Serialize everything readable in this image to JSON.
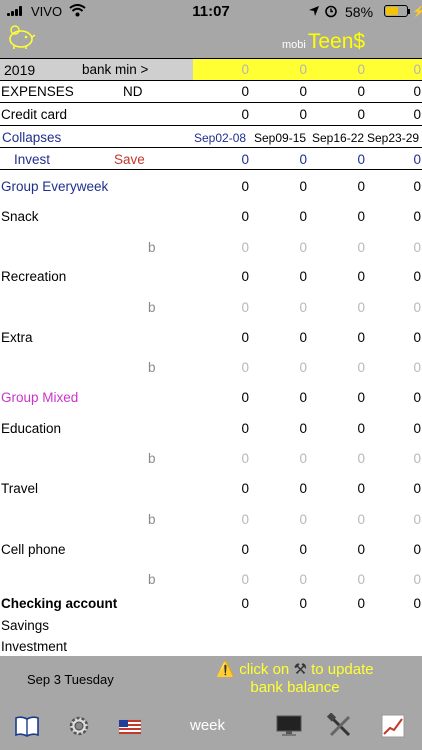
{
  "status": {
    "carrier": "VIVO",
    "time": "11:07",
    "battery": "58%",
    "battery_level": 0.58
  },
  "header": {
    "brand_small": "mobi",
    "brand_big": "Teen$"
  },
  "year_row": {
    "year": "2019",
    "label": "bank min >",
    "values": [
      "0",
      "0",
      "0",
      "0"
    ]
  },
  "expenses_row": {
    "label": "EXPENSES",
    "tag": "ND",
    "values": [
      "0",
      "0",
      "0",
      "0"
    ]
  },
  "credit_row": {
    "label": "Credit card",
    "values": [
      "0",
      "0",
      "0",
      "0"
    ]
  },
  "collapses_row": {
    "label": "Collapses",
    "weeks": [
      "Sep02-08",
      "Sep09-15",
      "Sep16-22",
      "Sep23-29"
    ]
  },
  "invest_row": {
    "invest": "Invest",
    "save": "Save",
    "values": [
      "0",
      "0",
      "0",
      "0"
    ]
  },
  "group_everyweek": {
    "label": "Group Everyweek",
    "values": [
      "0",
      "0",
      "0",
      "0"
    ]
  },
  "snack": {
    "label": "Snack",
    "values": [
      "0",
      "0",
      "0",
      "0"
    ],
    "b": "b",
    "b_values": [
      "0",
      "0",
      "0",
      "0"
    ]
  },
  "recreation": {
    "label": "Recreation",
    "values": [
      "0",
      "0",
      "0",
      "0"
    ],
    "b": "b",
    "b_values": [
      "0",
      "0",
      "0",
      "0"
    ]
  },
  "extra": {
    "label": "Extra",
    "values": [
      "0",
      "0",
      "0",
      "0"
    ],
    "b": "b",
    "b_values": [
      "0",
      "0",
      "0",
      "0"
    ]
  },
  "group_mixed": {
    "label": "Group Mixed",
    "values": [
      "0",
      "0",
      "0",
      "0"
    ]
  },
  "education": {
    "label": "Education",
    "values": [
      "0",
      "0",
      "0",
      "0"
    ],
    "b": "b",
    "b_values": [
      "0",
      "0",
      "0",
      "0"
    ]
  },
  "travel": {
    "label": "Travel",
    "values": [
      "0",
      "0",
      "0",
      "0"
    ],
    "b": "b",
    "b_values": [
      "0",
      "0",
      "0",
      "0"
    ]
  },
  "cellphone": {
    "label": "Cell phone",
    "values": [
      "0",
      "0",
      "0",
      "0"
    ],
    "b": "b",
    "b_values": [
      "0",
      "0",
      "0",
      "0"
    ]
  },
  "checking": {
    "label": "Checking account",
    "values": [
      "0",
      "0",
      "0",
      "0"
    ]
  },
  "savings": {
    "label": "Savings"
  },
  "investment": {
    "label": "Investment"
  },
  "footer": {
    "date": "Sep 3 Tuesday",
    "hint_line1": "click on",
    "hint_line1b": "to update",
    "hint_line2": "bank balance"
  },
  "tabbar": {
    "week": "week"
  },
  "icons": {
    "logo": "piggy-bank-icon",
    "book": "book-icon",
    "settings": "gear-icon",
    "flag": "us-flag-icon",
    "monitor": "monitor-icon",
    "tools": "tools-icon",
    "chart": "chart-icon",
    "warning": "warning-icon"
  },
  "colors": {
    "bar_gray": "#a7a7a7",
    "highlight_yellow": "#ffff33",
    "group_blue": "#1f2f8f",
    "group_magenta": "#cc33cc",
    "save_red": "#c0392b"
  }
}
